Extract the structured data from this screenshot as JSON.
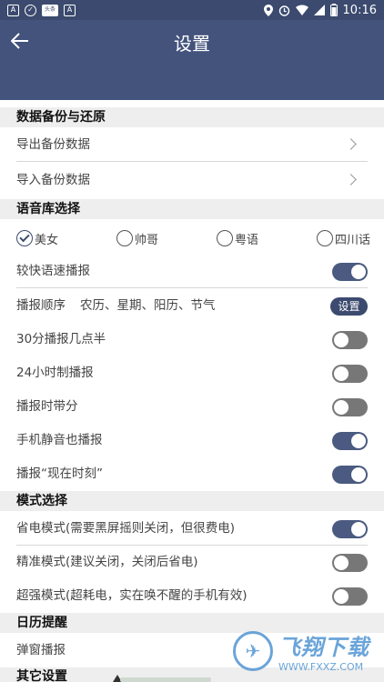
{
  "statusbar": {
    "left_icons": [
      "A-badge-icon",
      "shield-icon",
      "tag-icon",
      "font-a-icon"
    ],
    "tag_text": "头条",
    "a_text": "A",
    "time": "10:16"
  },
  "appbar": {
    "title": "设置"
  },
  "sections": {
    "backup": "数据备份与还原",
    "voice_lib": "语音库选择",
    "mode": "模式选择",
    "calendar": "日历提醒",
    "other": "其它设置"
  },
  "backup": {
    "export": "导出备份数据",
    "import": "导入备份数据"
  },
  "voices": {
    "options": [
      "美女",
      "帅哥",
      "粤语",
      "四川话"
    ],
    "selected": "美女"
  },
  "broadcast": {
    "fast_speed": {
      "label": "较快语速播报",
      "on": true
    },
    "order": {
      "label": "播报顺序",
      "value": "农历、星期、阳历、节气",
      "button": "设置"
    },
    "half_hour": {
      "label": "30分播报几点半",
      "on": false
    },
    "h24": {
      "label": "24小时制播报",
      "on": false
    },
    "with_minutes": {
      "label": "播报时带分",
      "on": false
    },
    "silent": {
      "label": "手机静音也播报",
      "on": true
    },
    "now_time": {
      "label": "播报“现在时刻”",
      "on": true
    }
  },
  "modes": {
    "power_save": {
      "label": "省电模式(需要黑屏摇则关闭，但很费电)",
      "on": true
    },
    "precise": {
      "label": "精准模式(建议关闭，关闭后省电)",
      "on": false
    },
    "super": {
      "label": "超强模式(超耗电，实在唤不醒的手机有效)",
      "on": false
    }
  },
  "calendar": {
    "popup": "弹窗播报"
  },
  "watermark": {
    "main": "飞翔下载",
    "sub": "WWW.FXXZ.COM"
  },
  "colors": {
    "primary": "#43537c",
    "statusbar": "#3b4a6e",
    "toggle_on": "#4a5a80",
    "toggle_off": "#777777"
  }
}
